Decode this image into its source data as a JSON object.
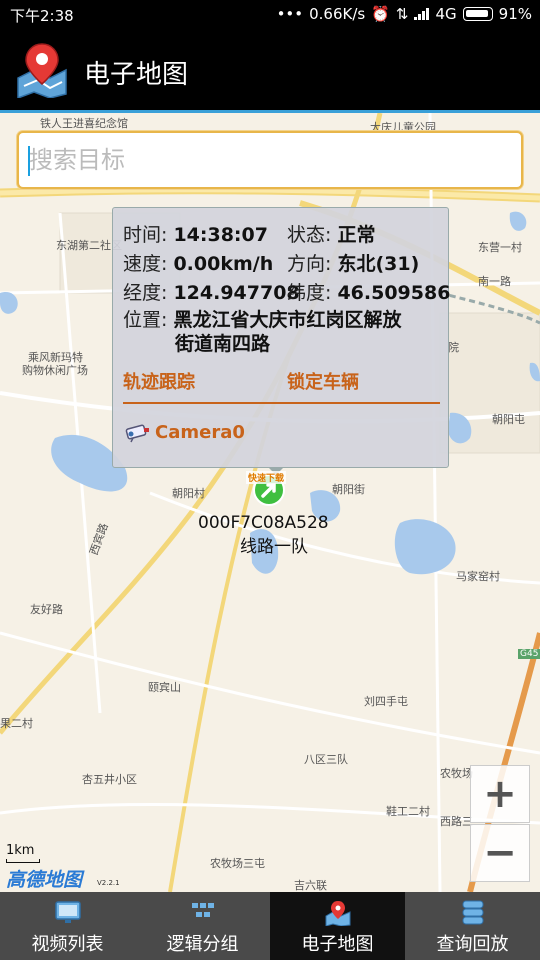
{
  "status_bar": {
    "time": "下午2:38",
    "speed": "0.66K/s",
    "network": "4G",
    "battery": "91%"
  },
  "header": {
    "title": "电子地图"
  },
  "search": {
    "placeholder": "搜索目标"
  },
  "map_labels": [
    "铁人王进喜纪念馆",
    "大庆儿童公园",
    "东湖第二社区",
    "乘风新玛特",
    "购物休闲广场",
    "东营一村",
    "南一路",
    "朝阳街",
    "朝阳屯",
    "朝阳村",
    "西宾路",
    "友好路",
    "马家窑村",
    "刘四手屯",
    "八区三队",
    "农牧场",
    "杏五井小区",
    "农牧场三屯",
    "鞋工二村",
    "西路三",
    "吉六联",
    "果二村",
    "颐宾山",
    "院",
    "G45"
  ],
  "popup": {
    "time_label": "时间:",
    "time_value": "14:38:07",
    "status_label": "状态:",
    "status_value": "正常",
    "speed_label": "速度:",
    "speed_value": "0.00km/h",
    "direction_label": "方向:",
    "direction_value": "东北(31)",
    "longitude_label": "经度:",
    "longitude_value": "124.947708",
    "latitude_label": "纬度:",
    "latitude_value": "46.509586",
    "location_label": "位置:",
    "location_line1": "黑龙江省大庆市红岗区解放",
    "location_line2": "街道南四路",
    "track_action": "轨迹跟踪",
    "lock_action": "锁定车辆",
    "camera": "Camera0"
  },
  "vehicle": {
    "id": "000F7C08A528",
    "group": "线路一队",
    "badge": "快速下载"
  },
  "map_controls": {
    "zoom_in": "+",
    "zoom_out": "−",
    "scale": "1km",
    "brand": "高德地图",
    "brand_version": "V2.2.1"
  },
  "bottom_nav": [
    {
      "label": "视频列表",
      "icon": "monitor-icon"
    },
    {
      "label": "逻辑分组",
      "icon": "group-icon"
    },
    {
      "label": "电子地图",
      "icon": "map-icon"
    },
    {
      "label": "查询回放",
      "icon": "database-icon"
    }
  ],
  "colors": {
    "accent_orange": "#c8631a",
    "search_border": "#e8b64a",
    "header_blue_line": "#3aa0d8",
    "nav_bg": "#4a4a4a",
    "nav_active_bg": "#111111"
  }
}
